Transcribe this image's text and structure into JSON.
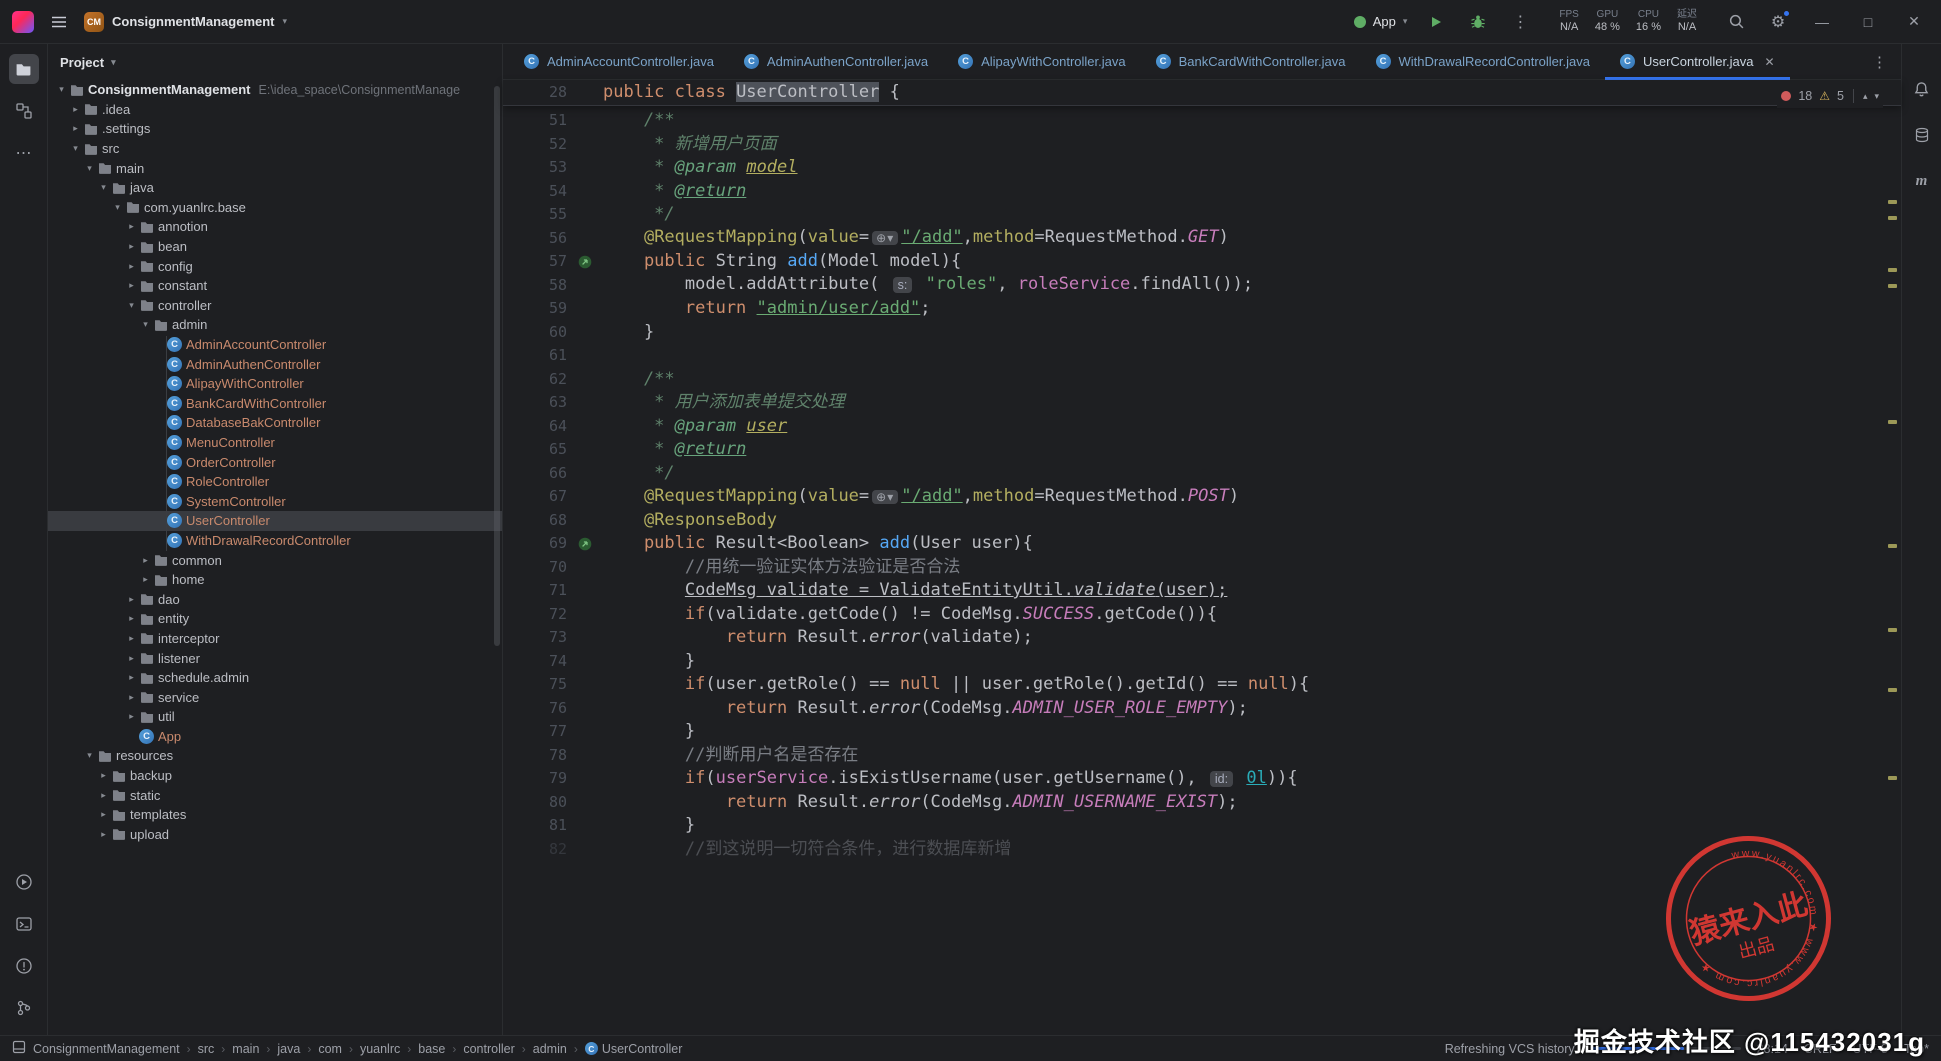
{
  "titlebar": {
    "project": "ConsignmentManagement",
    "project_abbr": "CM",
    "run_config": "App",
    "perf": [
      {
        "label": "FPS",
        "value": "N/A"
      },
      {
        "label": "GPU",
        "value": "48 %"
      },
      {
        "label": "CPU",
        "value": "16 %"
      },
      {
        "label": "延迟",
        "value": "N/A"
      }
    ]
  },
  "glyphs": {
    "chevron_down": "▾",
    "chev_up": "▴",
    "chevron_right": "▸",
    "more_vertical": "⋮",
    "more_horizontal": "⋯",
    "minimize": "—",
    "maximize": "□",
    "close": "✕",
    "gear": "⚙",
    "warning": "⚠",
    "breadcrumb_sep": "›",
    "globe": "⊕▾"
  },
  "project": {
    "title": "Project",
    "tree": [
      {
        "label": "ConsignmentManagement",
        "path": "E:\\idea_space\\ConsignmentManage",
        "indent": 0,
        "chevron": "down",
        "icon": "folder",
        "bold": true
      },
      {
        "label": ".idea",
        "indent": 1,
        "chevron": "right",
        "icon": "folder"
      },
      {
        "label": ".settings",
        "indent": 1,
        "chevron": "right",
        "icon": "folder"
      },
      {
        "label": "src",
        "indent": 1,
        "chevron": "down",
        "icon": "folder"
      },
      {
        "label": "main",
        "indent": 2,
        "chevron": "down",
        "icon": "folder"
      },
      {
        "label": "java",
        "indent": 3,
        "chevron": "down",
        "icon": "folder"
      },
      {
        "label": "com.yuanlrc.base",
        "indent": 4,
        "chevron": "down",
        "icon": "package"
      },
      {
        "label": "annotion",
        "indent": 5,
        "chevron": "right",
        "icon": "package"
      },
      {
        "label": "bean",
        "indent": 5,
        "chevron": "right",
        "icon": "package"
      },
      {
        "label": "config",
        "indent": 5,
        "chevron": "right",
        "icon": "package"
      },
      {
        "label": "constant",
        "indent": 5,
        "chevron": "right",
        "icon": "package"
      },
      {
        "label": "controller",
        "indent": 5,
        "chevron": "down",
        "icon": "package"
      },
      {
        "label": "admin",
        "indent": 6,
        "chevron": "down",
        "icon": "package"
      },
      {
        "label": "AdminAccountController",
        "indent": 7,
        "icon": "class",
        "cls": true
      },
      {
        "label": "AdminAuthenController",
        "indent": 7,
        "icon": "class",
        "cls": true
      },
      {
        "label": "AlipayWithController",
        "indent": 7,
        "icon": "class",
        "cls": true
      },
      {
        "label": "BankCardWithController",
        "indent": 7,
        "icon": "class",
        "cls": true
      },
      {
        "label": "DatabaseBakController",
        "indent": 7,
        "icon": "class",
        "cls": true
      },
      {
        "label": "MenuController",
        "indent": 7,
        "icon": "class",
        "cls": true
      },
      {
        "label": "OrderController",
        "indent": 7,
        "icon": "class",
        "cls": true
      },
      {
        "label": "RoleController",
        "indent": 7,
        "icon": "class",
        "cls": true
      },
      {
        "label": "SystemController",
        "indent": 7,
        "icon": "class",
        "cls": true
      },
      {
        "label": "UserController",
        "indent": 7,
        "icon": "class",
        "cls": true,
        "selected": true
      },
      {
        "label": "WithDrawalRecordController",
        "indent": 7,
        "icon": "class",
        "cls": true
      },
      {
        "label": "common",
        "indent": 6,
        "chevron": "right",
        "icon": "package"
      },
      {
        "label": "home",
        "indent": 6,
        "chevron": "right",
        "icon": "package"
      },
      {
        "label": "dao",
        "indent": 5,
        "chevron": "right",
        "icon": "package"
      },
      {
        "label": "entity",
        "indent": 5,
        "chevron": "right",
        "icon": "package"
      },
      {
        "label": "interceptor",
        "indent": 5,
        "chevron": "right",
        "icon": "package"
      },
      {
        "label": "listener",
        "indent": 5,
        "chevron": "right",
        "icon": "package"
      },
      {
        "label": "schedule.admin",
        "indent": 5,
        "chevron": "right",
        "icon": "package"
      },
      {
        "label": "service",
        "indent": 5,
        "chevron": "right",
        "icon": "package"
      },
      {
        "label": "util",
        "indent": 5,
        "chevron": "right",
        "icon": "package"
      },
      {
        "label": "App",
        "indent": 5,
        "icon": "class",
        "cls": true
      },
      {
        "label": "resources",
        "indent": 2,
        "chevron": "down",
        "icon": "folder"
      },
      {
        "label": "backup",
        "indent": 3,
        "chevron": "right",
        "icon": "folder"
      },
      {
        "label": "static",
        "indent": 3,
        "chevron": "right",
        "icon": "folder"
      },
      {
        "label": "templates",
        "indent": 3,
        "chevron": "right",
        "icon": "folder"
      },
      {
        "label": "upload",
        "indent": 3,
        "chevron": "right",
        "icon": "folder"
      }
    ]
  },
  "tabs": [
    {
      "label": "AdminAccountController.java"
    },
    {
      "label": "AdminAuthenController.java"
    },
    {
      "label": "AlipayWithController.java"
    },
    {
      "label": "BankCardWithController.java"
    },
    {
      "label": "WithDrawalRecordController.java"
    },
    {
      "label": "UserController.java",
      "active": true
    }
  ],
  "editor": {
    "inspections": {
      "errors": "18",
      "warnings": "5"
    },
    "stripe_marks": [
      156,
      172,
      224,
      240,
      376,
      500,
      584,
      644,
      732
    ],
    "sticky": {
      "n": 28,
      "t": [
        [
          "k",
          "public class "
        ],
        [
          "hl",
          "UserController"
        ],
        [
          "p",
          " {"
        ]
      ]
    },
    "lines": [
      {
        "n": 51,
        "t": [
          [
            "d",
            "    /**"
          ]
        ]
      },
      {
        "n": 52,
        "t": [
          [
            "d",
            "     * 新增用户页面"
          ]
        ]
      },
      {
        "n": 53,
        "t": [
          [
            "d",
            "     * "
          ],
          [
            "dt",
            "@param"
          ],
          [
            "d",
            " "
          ],
          [
            "dv",
            "model"
          ]
        ]
      },
      {
        "n": 54,
        "t": [
          [
            "d",
            "     * "
          ],
          [
            "dtu",
            "@return"
          ]
        ]
      },
      {
        "n": 55,
        "t": [
          [
            "d",
            "     */"
          ]
        ]
      },
      {
        "n": 56,
        "t": [
          [
            "p",
            "    "
          ],
          [
            "a",
            "@RequestMapping"
          ],
          [
            "p",
            "("
          ],
          [
            "a",
            "value"
          ],
          [
            "p",
            "="
          ],
          [
            "g",
            "⊕▾"
          ],
          [
            "su",
            "\"/add\""
          ],
          [
            "p",
            ","
          ],
          [
            "a",
            "method"
          ],
          [
            "p",
            "="
          ],
          [
            "p",
            "RequestMethod."
          ],
          [
            "ct",
            "GET"
          ],
          [
            "p",
            ")"
          ]
        ]
      },
      {
        "n": 57,
        "g": true,
        "t": [
          [
            "k",
            "    public"
          ],
          [
            "p",
            " String "
          ],
          [
            "m",
            "add"
          ],
          [
            "p",
            "(Model model){"
          ]
        ]
      },
      {
        "n": 58,
        "t": [
          [
            "p",
            "        model.addAttribute( "
          ],
          [
            "h",
            "s:"
          ],
          [
            "p",
            " "
          ],
          [
            "s",
            "\"roles\""
          ],
          [
            "p",
            ", "
          ],
          [
            "f",
            "roleService"
          ],
          [
            "p",
            ".findAll());"
          ]
        ]
      },
      {
        "n": 59,
        "t": [
          [
            "k",
            "        return "
          ],
          [
            "su",
            "\"admin/user/add\""
          ],
          [
            "p",
            ";"
          ]
        ]
      },
      {
        "n": 60,
        "t": [
          [
            "p",
            "    }"
          ]
        ]
      },
      {
        "n": 61,
        "t": []
      },
      {
        "n": 62,
        "t": [
          [
            "d",
            "    /**"
          ]
        ]
      },
      {
        "n": 63,
        "t": [
          [
            "d",
            "     * 用户添加表单提交处理"
          ]
        ]
      },
      {
        "n": 64,
        "t": [
          [
            "d",
            "     * "
          ],
          [
            "dt",
            "@param"
          ],
          [
            "d",
            " "
          ],
          [
            "dv",
            "user"
          ]
        ]
      },
      {
        "n": 65,
        "t": [
          [
            "d",
            "     * "
          ],
          [
            "dtu",
            "@return"
          ]
        ]
      },
      {
        "n": 66,
        "t": [
          [
            "d",
            "     */"
          ]
        ]
      },
      {
        "n": 67,
        "t": [
          [
            "p",
            "    "
          ],
          [
            "a",
            "@RequestMapping"
          ],
          [
            "p",
            "("
          ],
          [
            "a",
            "value"
          ],
          [
            "p",
            "="
          ],
          [
            "g",
            "⊕▾"
          ],
          [
            "su",
            "\"/add\""
          ],
          [
            "p",
            ","
          ],
          [
            "a",
            "method"
          ],
          [
            "p",
            "="
          ],
          [
            "p",
            "RequestMethod."
          ],
          [
            "ct",
            "POST"
          ],
          [
            "p",
            ")"
          ]
        ]
      },
      {
        "n": 68,
        "t": [
          [
            "p",
            "    "
          ],
          [
            "a",
            "@ResponseBody"
          ]
        ]
      },
      {
        "n": 69,
        "g": true,
        "t": [
          [
            "k",
            "    public"
          ],
          [
            "p",
            " Result<Boolean> "
          ],
          [
            "m",
            "add"
          ],
          [
            "p",
            "(User user){"
          ]
        ]
      },
      {
        "n": 70,
        "t": [
          [
            "c",
            "        //用统一验证实体方法验证是否合法"
          ]
        ]
      },
      {
        "n": 71,
        "t": [
          [
            "p",
            "        "
          ],
          [
            "pu",
            "CodeMsg validate = ValidateEntityUtil."
          ],
          [
            "iu",
            "validate"
          ],
          [
            "pu",
            "(user);"
          ]
        ]
      },
      {
        "n": 72,
        "t": [
          [
            "k",
            "        if"
          ],
          [
            "p",
            "(validate.getCode() != CodeMsg."
          ],
          [
            "ct",
            "SUCCESS"
          ],
          [
            "p",
            ".getCode()){"
          ]
        ]
      },
      {
        "n": 73,
        "t": [
          [
            "k",
            "            return "
          ],
          [
            "p",
            "Result."
          ],
          [
            "i",
            "error"
          ],
          [
            "p",
            "(validate);"
          ]
        ]
      },
      {
        "n": 74,
        "t": [
          [
            "p",
            "        }"
          ]
        ]
      },
      {
        "n": 75,
        "t": [
          [
            "k",
            "        if"
          ],
          [
            "p",
            "(user.getRole() == "
          ],
          [
            "k",
            "null"
          ],
          [
            "p",
            " || user.getRole().getId() == "
          ],
          [
            "k",
            "null"
          ],
          [
            "p",
            "){"
          ]
        ]
      },
      {
        "n": 76,
        "t": [
          [
            "k",
            "            return "
          ],
          [
            "p",
            "Result."
          ],
          [
            "i",
            "error"
          ],
          [
            "p",
            "(CodeMsg."
          ],
          [
            "ct",
            "ADMIN_USER_ROLE_EMPTY"
          ],
          [
            "p",
            ");"
          ]
        ]
      },
      {
        "n": 77,
        "t": [
          [
            "p",
            "        }"
          ]
        ]
      },
      {
        "n": 78,
        "t": [
          [
            "c",
            "        //判断用户名是否存在"
          ]
        ]
      },
      {
        "n": 79,
        "t": [
          [
            "k",
            "        if"
          ],
          [
            "p",
            "("
          ],
          [
            "f",
            "userService"
          ],
          [
            "p",
            ".isExistUsername(user.getUsername(), "
          ],
          [
            "h",
            "id:"
          ],
          [
            "p",
            " "
          ],
          [
            "nu",
            "0l"
          ],
          [
            "p",
            ")){"
          ]
        ]
      },
      {
        "n": 80,
        "t": [
          [
            "k",
            "            return "
          ],
          [
            "p",
            "Result."
          ],
          [
            "i",
            "error"
          ],
          [
            "p",
            "(CodeMsg."
          ],
          [
            "ct",
            "ADMIN_USERNAME_EXIST"
          ],
          [
            "p",
            ");"
          ]
        ]
      },
      {
        "n": 81,
        "t": [
          [
            "p",
            "        }"
          ]
        ]
      },
      {
        "n": 82,
        "dim": true,
        "t": [
          [
            "c",
            "        //到这说明一切符合条件，进行数据库新增"
          ]
        ]
      }
    ]
  },
  "breadcrumbs": [
    "ConsignmentManagement",
    "src",
    "main",
    "java",
    "com",
    "yuanlrc",
    "base",
    "controller",
    "admin",
    "UserController"
  ],
  "statusbar": {
    "vcs": "Refreshing VCS history",
    "position": "28:14",
    "line_ending": "CRLF",
    "encoding": "UTF-8",
    "indent": "Tab*"
  },
  "watermark": {
    "credit": "掘金技术社区 @115432031g",
    "stamp_line1": "猿来入此",
    "stamp_line2": "出品",
    "stamp_ring": "www.yuanlrc.com ★ www.yuanlrc.com ★"
  }
}
